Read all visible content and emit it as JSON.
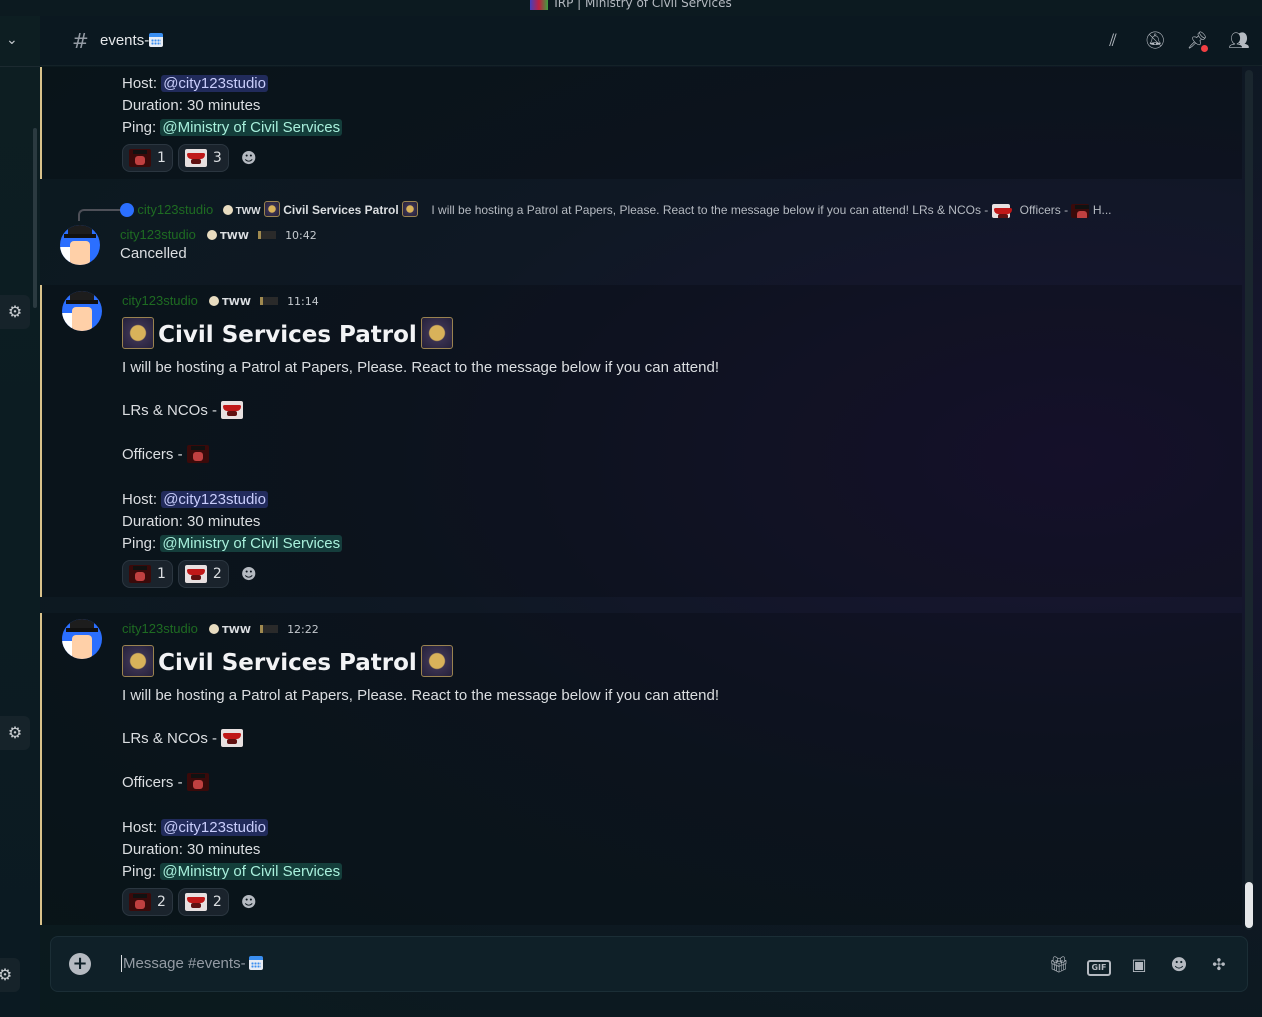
{
  "window": {
    "title": "IRP | Ministry of Civil Services"
  },
  "header": {
    "channel_prefix": "#",
    "channel_name": "events-",
    "icons": [
      "threads-icon",
      "mute-icon",
      "pin-icon",
      "members-icon"
    ]
  },
  "messages": [
    {
      "host_label": "Host:",
      "host": "@city123studio",
      "duration": "Duration: 30 minutes",
      "ping_label": "Ping:",
      "ping": "@Ministry of Civil Services",
      "reactions": [
        {
          "emoji": "officer-emoji",
          "count": "1"
        },
        {
          "emoji": "lr-emoji",
          "count": "3"
        }
      ]
    },
    {
      "reply": {
        "author": "city123studio",
        "tag": "TWW",
        "title": "Civil Services Patrol",
        "text": "I will be hosting a Patrol at Papers, Please. React to the message below if you can attend!  LRs & NCOs -",
        "officers": "Officers -",
        "trail": "H..."
      },
      "author": "city123studio",
      "tag": "TWW",
      "time": "10:42",
      "body": "Cancelled"
    },
    {
      "author": "city123studio",
      "tag": "TWW",
      "time": "11:14",
      "title": "Civil Services Patrol",
      "intro": "I will be hosting a Patrol at Papers, Please. React to the message below if you can attend!",
      "lrs": "LRs & NCOs -",
      "officers": "Officers -",
      "host_label": "Host:",
      "host": "@city123studio",
      "duration": "Duration: 30 minutes",
      "ping_label": "Ping:",
      "ping": "@Ministry of Civil Services",
      "reactions": [
        {
          "emoji": "officer-emoji",
          "count": "1"
        },
        {
          "emoji": "lr-emoji",
          "count": "2"
        }
      ]
    },
    {
      "author": "city123studio",
      "tag": "TWW",
      "time": "12:22",
      "title": "Civil Services Patrol",
      "intro": "I will be hosting a Patrol at Papers, Please. React to the message below if you can attend!",
      "lrs": "LRs & NCOs -",
      "officers": "Officers -",
      "host_label": "Host:",
      "host": "@city123studio",
      "duration": "Duration: 30 minutes",
      "ping_label": "Ping:",
      "ping": "@Ministry of Civil Services",
      "reactions": [
        {
          "emoji": "officer-emoji",
          "count": "2"
        },
        {
          "emoji": "lr-emoji",
          "count": "2"
        }
      ]
    }
  ],
  "composer": {
    "placeholder": "Message #events-",
    "icons": [
      "gift-icon",
      "gif-icon",
      "sticker-icon",
      "emoji-icon",
      "apps-icon"
    ],
    "gif_label": "GIF"
  },
  "colors": {
    "accent": "#5865f2",
    "username": "#1e6b22",
    "highlight_border": "#d9c28b"
  }
}
